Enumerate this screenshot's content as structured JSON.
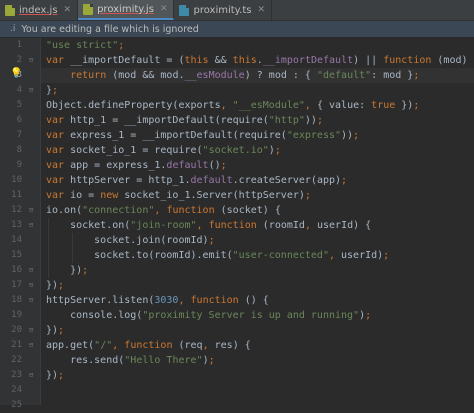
{
  "tabs": [
    {
      "label": "index.js",
      "type": "js",
      "active": false
    },
    {
      "label": "proximity.js",
      "type": "js",
      "active": true
    },
    {
      "label": "proximity.ts",
      "type": "ts",
      "active": false
    }
  ],
  "banner": {
    "text": "You are editing a file which is ignored"
  },
  "line_numbers": [
    "1",
    "2",
    "3",
    "4",
    "5",
    "6",
    "7",
    "8",
    "9",
    "10",
    "11",
    "12",
    "13",
    "14",
    "15",
    "16",
    "17",
    "18",
    "19",
    "20",
    "21",
    "22",
    "23",
    "24",
    "25"
  ],
  "code_lines": [
    "\"use strict\";",
    "var __importDefault = (this && this.__importDefault) || function (mod) {",
    "    return (mod && mod.__esModule) ? mod : { \"default\": mod };",
    "};",
    "Object.defineProperty(exports, \"__esModule\", { value: true });",
    "var http_1 = __importDefault(require(\"http\"));",
    "var express_1 = __importDefault(require(\"express\"));",
    "var socket_io_1 = require(\"socket.io\");",
    "var app = express_1.default();",
    "var httpServer = http_1.default.createServer(app);",
    "var io = new socket_io_1.Server(httpServer);",
    "io.on(\"connection\", function (socket) {",
    "    socket.on(\"join-room\", function (roomId, userId) {",
    "        socket.join(roomId);",
    "        socket.to(roomId).emit(\"user-connected\", userId);",
    "    });",
    "});",
    "httpServer.listen(3030, function () {",
    "    console.log(\"proximity Server is up and running\");",
    "});",
    "app.get(\"/\", function (req, res) {",
    "    res.send(\"Hello There\");",
    "});",
    "",
    ""
  ],
  "current_line": 3,
  "colors": {
    "background": "#2b2b2b",
    "keyword": "#cc7832",
    "string": "#6a8759",
    "number": "#6897bb",
    "field": "#9876aa",
    "text": "#a9b7c6"
  },
  "icons": {
    "tab_file": "js-file-icon",
    "banner": "info-icon",
    "intention": "lightbulb-icon"
  }
}
